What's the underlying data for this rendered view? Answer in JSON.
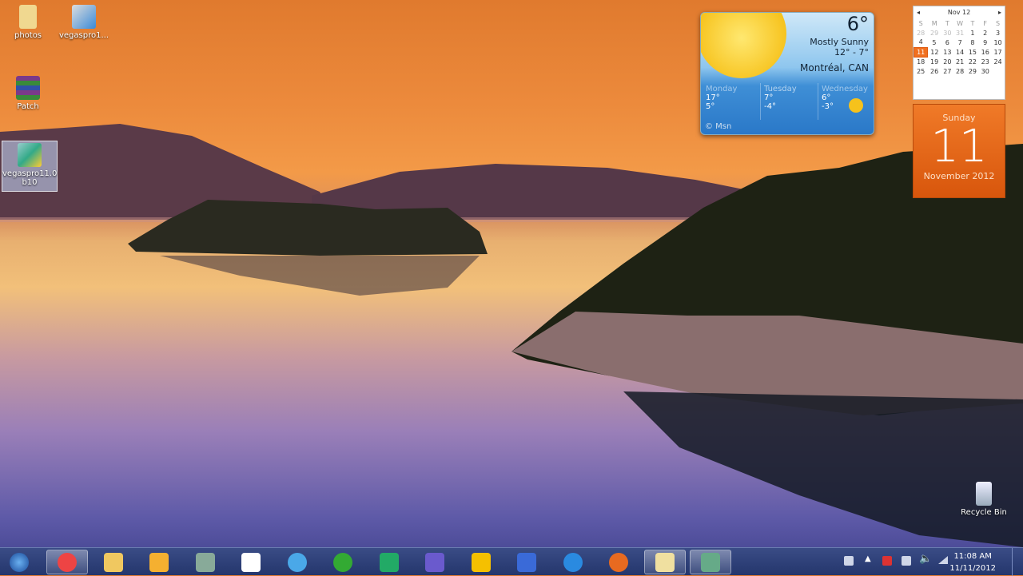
{
  "desktop_icons": [
    {
      "label": "photos"
    },
    {
      "label": "vegaspro1..."
    },
    {
      "label": "Patch"
    },
    {
      "label": "vegaspro11.0 b10"
    },
    {
      "label": "Recycle Bin"
    }
  ],
  "weather": {
    "temp": "6°",
    "condition": "Mostly Sunny",
    "range": "12° - 7°",
    "location": "Montréal, CAN",
    "source": "© Msn",
    "forecast": [
      {
        "day": "Monday",
        "high": "17°",
        "low": "5°"
      },
      {
        "day": "Tuesday",
        "high": "7°",
        "low": "-4°"
      },
      {
        "day": "Wednesday",
        "high": "6°",
        "low": "-3°"
      }
    ]
  },
  "calendar": {
    "month_label": "Nov 12",
    "prev": "◂",
    "next": "▸",
    "weekdays": [
      "S",
      "M",
      "T",
      "W",
      "T",
      "F",
      "S"
    ],
    "weeks": [
      [
        "28",
        "29",
        "30",
        "31",
        "1",
        "2",
        "3"
      ],
      [
        "4",
        "5",
        "6",
        "7",
        "8",
        "9",
        "10"
      ],
      [
        "11",
        "12",
        "13",
        "14",
        "15",
        "16",
        "17"
      ],
      [
        "18",
        "19",
        "20",
        "21",
        "22",
        "23",
        "24"
      ],
      [
        "25",
        "26",
        "27",
        "28",
        "29",
        "30",
        ""
      ]
    ],
    "today": "11",
    "weekday": "Sunday",
    "month_year": "November 2012"
  },
  "taskbar": {
    "apps": [
      "Google Chrome",
      "Windows Explorer",
      "Windows Media Player",
      "Application",
      "Document",
      "iTunes",
      "uTorrent",
      "Application",
      "After Effects",
      "Application",
      "Word",
      "QuickTime",
      "Firefox",
      "Windows Explorer",
      "Vegas Pro"
    ],
    "clock": {
      "time": "11:08 AM",
      "date": "11/11/2012"
    }
  },
  "colors": {
    "taskbar": "#2a3c74",
    "calendar_accent": "#e8661a"
  }
}
